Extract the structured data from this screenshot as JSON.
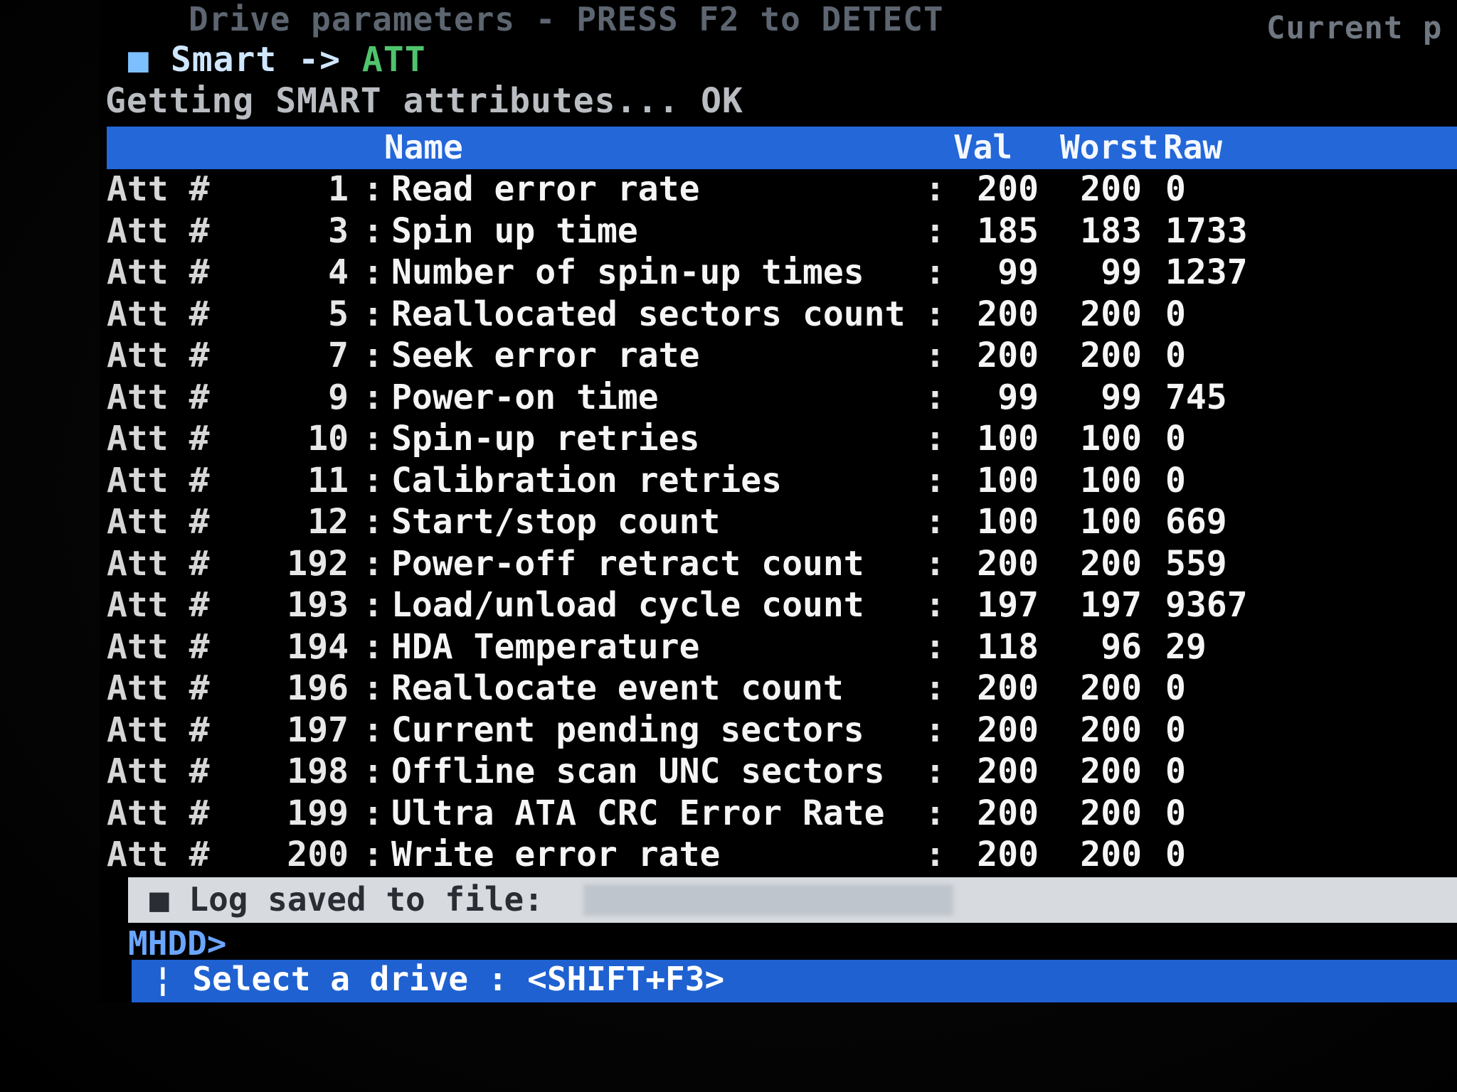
{
  "header": {
    "title": "Drive parameters - PRESS F2 to DETECT",
    "right_fragment": "Current p"
  },
  "menu": {
    "bullet": "■",
    "smart": "Smart ->",
    "att": "ATT"
  },
  "status": {
    "getting": "Getting SMART attributes... OK"
  },
  "table": {
    "columns": {
      "name": "Name",
      "val": "Val",
      "worst": "Worst",
      "raw": "Raw"
    },
    "att_prefix": "Att #",
    "rows": [
      {
        "id": "1",
        "name": "Read error rate",
        "val": "200",
        "worst": "200",
        "raw": "0"
      },
      {
        "id": "3",
        "name": "Spin up time",
        "val": "185",
        "worst": "183",
        "raw": "1733"
      },
      {
        "id": "4",
        "name": "Number of spin-up times",
        "val": "99",
        "worst": "99",
        "raw": "1237"
      },
      {
        "id": "5",
        "name": "Reallocated sectors count",
        "val": "200",
        "worst": "200",
        "raw": "0"
      },
      {
        "id": "7",
        "name": "Seek error rate",
        "val": "200",
        "worst": "200",
        "raw": "0"
      },
      {
        "id": "9",
        "name": "Power-on time",
        "val": "99",
        "worst": "99",
        "raw": "745"
      },
      {
        "id": "10",
        "name": "Spin-up retries",
        "val": "100",
        "worst": "100",
        "raw": "0"
      },
      {
        "id": "11",
        "name": "Calibration retries",
        "val": "100",
        "worst": "100",
        "raw": "0"
      },
      {
        "id": "12",
        "name": "Start/stop count",
        "val": "100",
        "worst": "100",
        "raw": "669"
      },
      {
        "id": "192",
        "name": "Power-off retract count",
        "val": "200",
        "worst": "200",
        "raw": "559"
      },
      {
        "id": "193",
        "name": "Load/unload cycle count",
        "val": "197",
        "worst": "197",
        "raw": "9367"
      },
      {
        "id": "194",
        "name": "HDA Temperature",
        "val": "118",
        "worst": "96",
        "raw": "29"
      },
      {
        "id": "196",
        "name": "Reallocate event count",
        "val": "200",
        "worst": "200",
        "raw": "0"
      },
      {
        "id": "197",
        "name": "Current pending sectors",
        "val": "200",
        "worst": "200",
        "raw": "0"
      },
      {
        "id": "198",
        "name": "Offline scan UNC sectors",
        "val": "200",
        "worst": "200",
        "raw": "0"
      },
      {
        "id": "199",
        "name": "Ultra ATA CRC Error Rate",
        "val": "200",
        "worst": "200",
        "raw": "0"
      },
      {
        "id": "200",
        "name": "Write error rate",
        "val": "200",
        "worst": "200",
        "raw": "0"
      }
    ]
  },
  "log": {
    "bullet": "■",
    "text": "Log saved to file:"
  },
  "prompt": {
    "text": "MHDD>"
  },
  "footer": {
    "text": "¦ Select a drive : <SHIFT+F3>"
  },
  "colors": {
    "header_bar": "#2367d8",
    "footer_bar": "#1f61d0",
    "log_bar": "#d7dbe0",
    "att_green": "#4fc46d"
  }
}
